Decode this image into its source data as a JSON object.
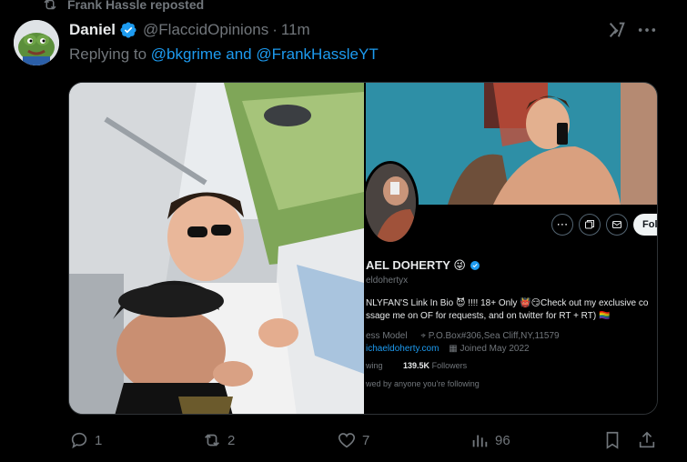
{
  "repost": {
    "text": "Frank Hassle reposted"
  },
  "post": {
    "author_name": "Daniel",
    "handle": "@FlaccidOpinions",
    "separator": "·",
    "time": "11m",
    "replying_prefix": "Replying to ",
    "replying_to": [
      "@bkgrime",
      "@FrankHassleYT"
    ],
    "replying_joiner": " and "
  },
  "screenshot_profile": {
    "name": "AEL DOHERTY 😜",
    "handle": "eldohertyx",
    "bio_line1": "NLYFAN'S Link In Bio 😈 !!!! 18+ Only 👹😏Check out my exclusive co",
    "bio_line2": "ssage me on OF for requests, and on twitter for RT + RT) 🏳️‍🌈",
    "meta_line1_a": "ess Model",
    "meta_line1_b": "P.O.Box#306,Sea Cliff,NY,11579",
    "meta_line2_link": "ichaeldoherty.com",
    "meta_line2_joined": "Joined May 2022",
    "following_label": "wing",
    "followers_count": "139.5K",
    "followers_label": "Followers",
    "followed_by": "wed by anyone you're following",
    "follow_button": "Fol"
  },
  "actions": {
    "replies": "1",
    "reposts": "2",
    "likes": "7",
    "views": "96"
  },
  "colors": {
    "accent": "#1d9bf0",
    "muted": "#71767b",
    "text": "#e7e9ea",
    "background": "#000000"
  },
  "icons": [
    "repost-icon",
    "verified-badge-icon",
    "grok-icon",
    "more-icon",
    "reply-icon",
    "retweet-icon",
    "like-icon",
    "views-icon",
    "bookmark-icon",
    "share-icon"
  ]
}
